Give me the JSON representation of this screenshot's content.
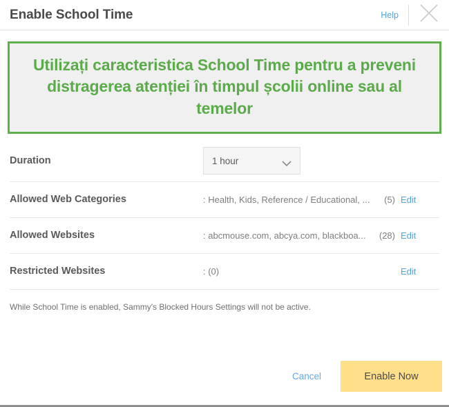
{
  "header": {
    "title": "Enable School Time",
    "help_label": "Help",
    "close_icon": "close-icon"
  },
  "banner": {
    "text": "Utilizați caracteristica School Time pentru a preveni distragerea atenției în timpul școlii online sau al temelor",
    "text_color": "#5cab4a",
    "border_color": "#5cb14c",
    "background_color": "#f0f0f0"
  },
  "settings": {
    "duration": {
      "label": "Duration",
      "value": "1 hour",
      "caret_icon": "chevron-down-icon"
    },
    "rows": [
      {
        "label": "Allowed Web Categories",
        "value": ": Health, Kids, Reference / Educational, ...",
        "count": "(5)",
        "edit_label": "Edit"
      },
      {
        "label": "Allowed Websites",
        "value": ": abcmouse.com, abcya.com, blackboa...",
        "count": "(28)",
        "edit_label": "Edit"
      },
      {
        "label": "Restricted Websites",
        "value": ": (0)",
        "count": "",
        "edit_label": "Edit"
      }
    ]
  },
  "note": "While School Time is enabled, Sammy's Blocked Hours Settings will not be active.",
  "footer": {
    "cancel_label": "Cancel",
    "enable_label": "Enable Now",
    "enable_color": "#ffdf8a",
    "link_color": "#4da6e0"
  }
}
